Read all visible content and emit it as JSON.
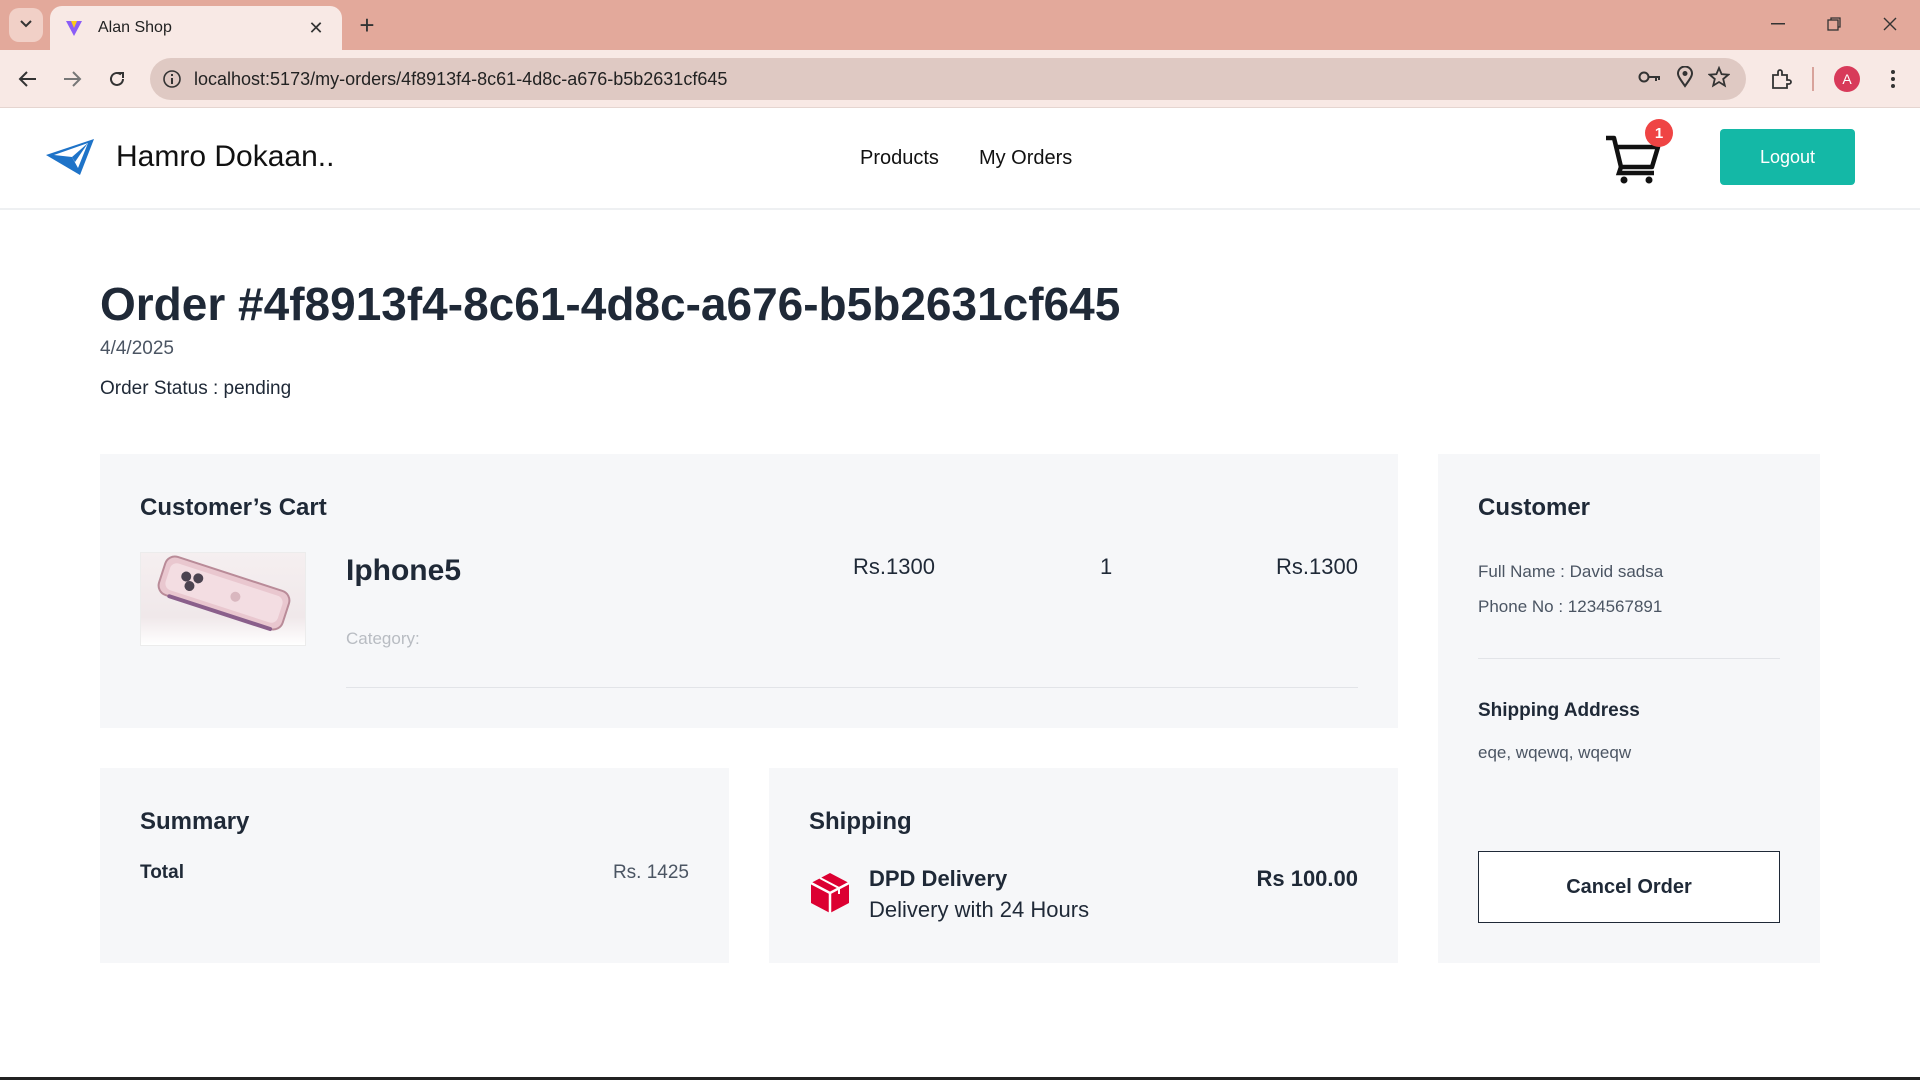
{
  "browser": {
    "tab_title": "Alan Shop",
    "url": "localhost:5173/my-orders/4f8913f4-8c61-4d8c-a676-b5b2631cf645",
    "profile_initial": "A",
    "chrome_color": "#e3a99b"
  },
  "header": {
    "brand_name": "Hamro Dokaan..",
    "nav": [
      "Products",
      "My Orders"
    ],
    "cart_count": "1",
    "logout_label": "Logout",
    "accent_color": "#14b8a6"
  },
  "order": {
    "title": "Order #4f8913f4-8c61-4d8c-a676-b5b2631cf645",
    "date": "4/4/2025",
    "status": "Order Status : pending"
  },
  "cart": {
    "heading": "Customer’s Cart",
    "items": [
      {
        "name": "Iphone5",
        "category": "Category:",
        "price": "Rs.1300",
        "quantity": "1",
        "total": "Rs.1300"
      }
    ]
  },
  "customer": {
    "heading": "Customer",
    "full_name": "Full Name : David sadsa",
    "phone": "Phone No : 1234567891",
    "shipping_address_heading": "Shipping Address",
    "shipping_address": "eqe, wqewq, wqeqw",
    "cancel_label": "Cancel Order"
  },
  "summary": {
    "heading": "Summary",
    "total_label": "Total",
    "total_value": "Rs. 1425"
  },
  "shipping": {
    "heading": "Shipping",
    "method_name": "DPD Delivery",
    "method_desc": "Delivery with 24 Hours",
    "price": "Rs 100.00",
    "icon_color": "#dc0032"
  }
}
